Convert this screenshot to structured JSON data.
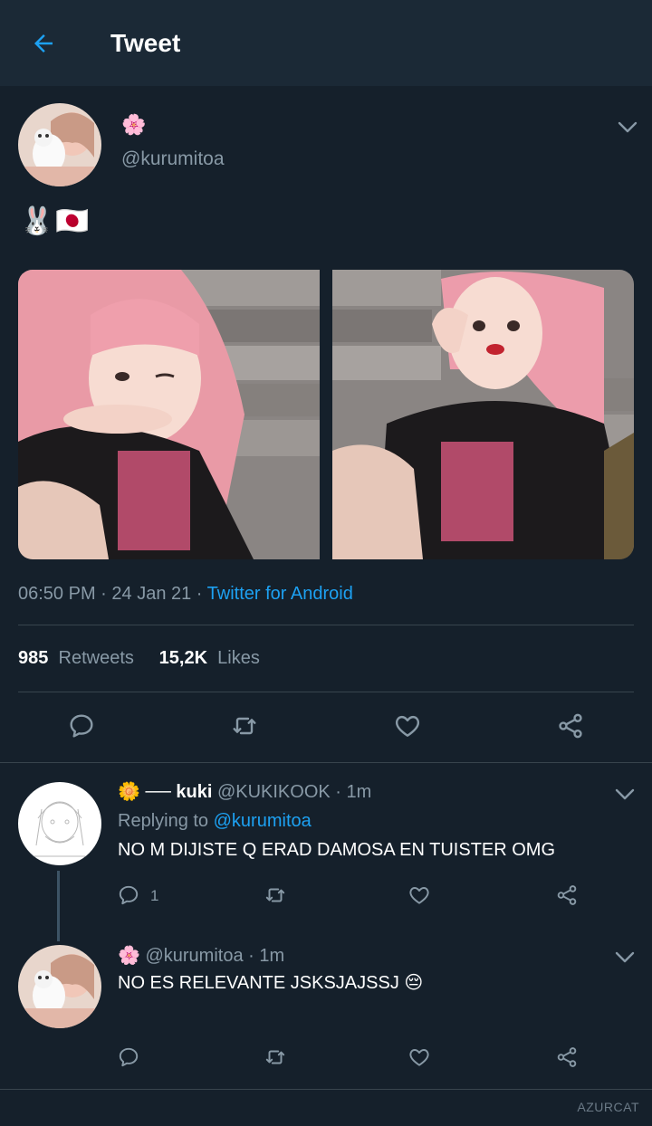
{
  "appbar": {
    "title": "Tweet"
  },
  "tweet": {
    "author_name_emoji": "🌸",
    "handle": "@kurumitoa",
    "text": "🐰🇯🇵",
    "time": "06:50 PM",
    "date": "24 Jan 21",
    "separator": " · ",
    "source": "Twitter for Android",
    "retweets_count": "985",
    "retweets_label": "Retweets",
    "likes_count": "15,2K",
    "likes_label": "Likes"
  },
  "replies": [
    {
      "name_prefix": "🌼 ── ",
      "name": "kuki",
      "handle": "@KUKIKOOK",
      "time": "· 1m",
      "replying_label": "Replying to",
      "replying_to": "@kurumitoa",
      "text": "NO M DIJISTE Q ERAD DAMOSA EN TUISTER OMG",
      "reply_count": "1"
    },
    {
      "name_prefix": "🌸",
      "handle": "@kurumitoa",
      "time": "· 1m",
      "text": "NO ES RELEVANTE JSKSJAJSSJ 😔"
    }
  ],
  "watermark": "AZURCAT",
  "colors": {
    "background": "#15202b",
    "appbar": "#1b2936",
    "accent": "#1da1f2",
    "secondary_text": "#8899a6",
    "divider": "#38444d"
  },
  "icons": [
    "back-arrow-icon",
    "chevron-down-icon",
    "reply-icon",
    "retweet-icon",
    "like-icon",
    "share-icon"
  ]
}
